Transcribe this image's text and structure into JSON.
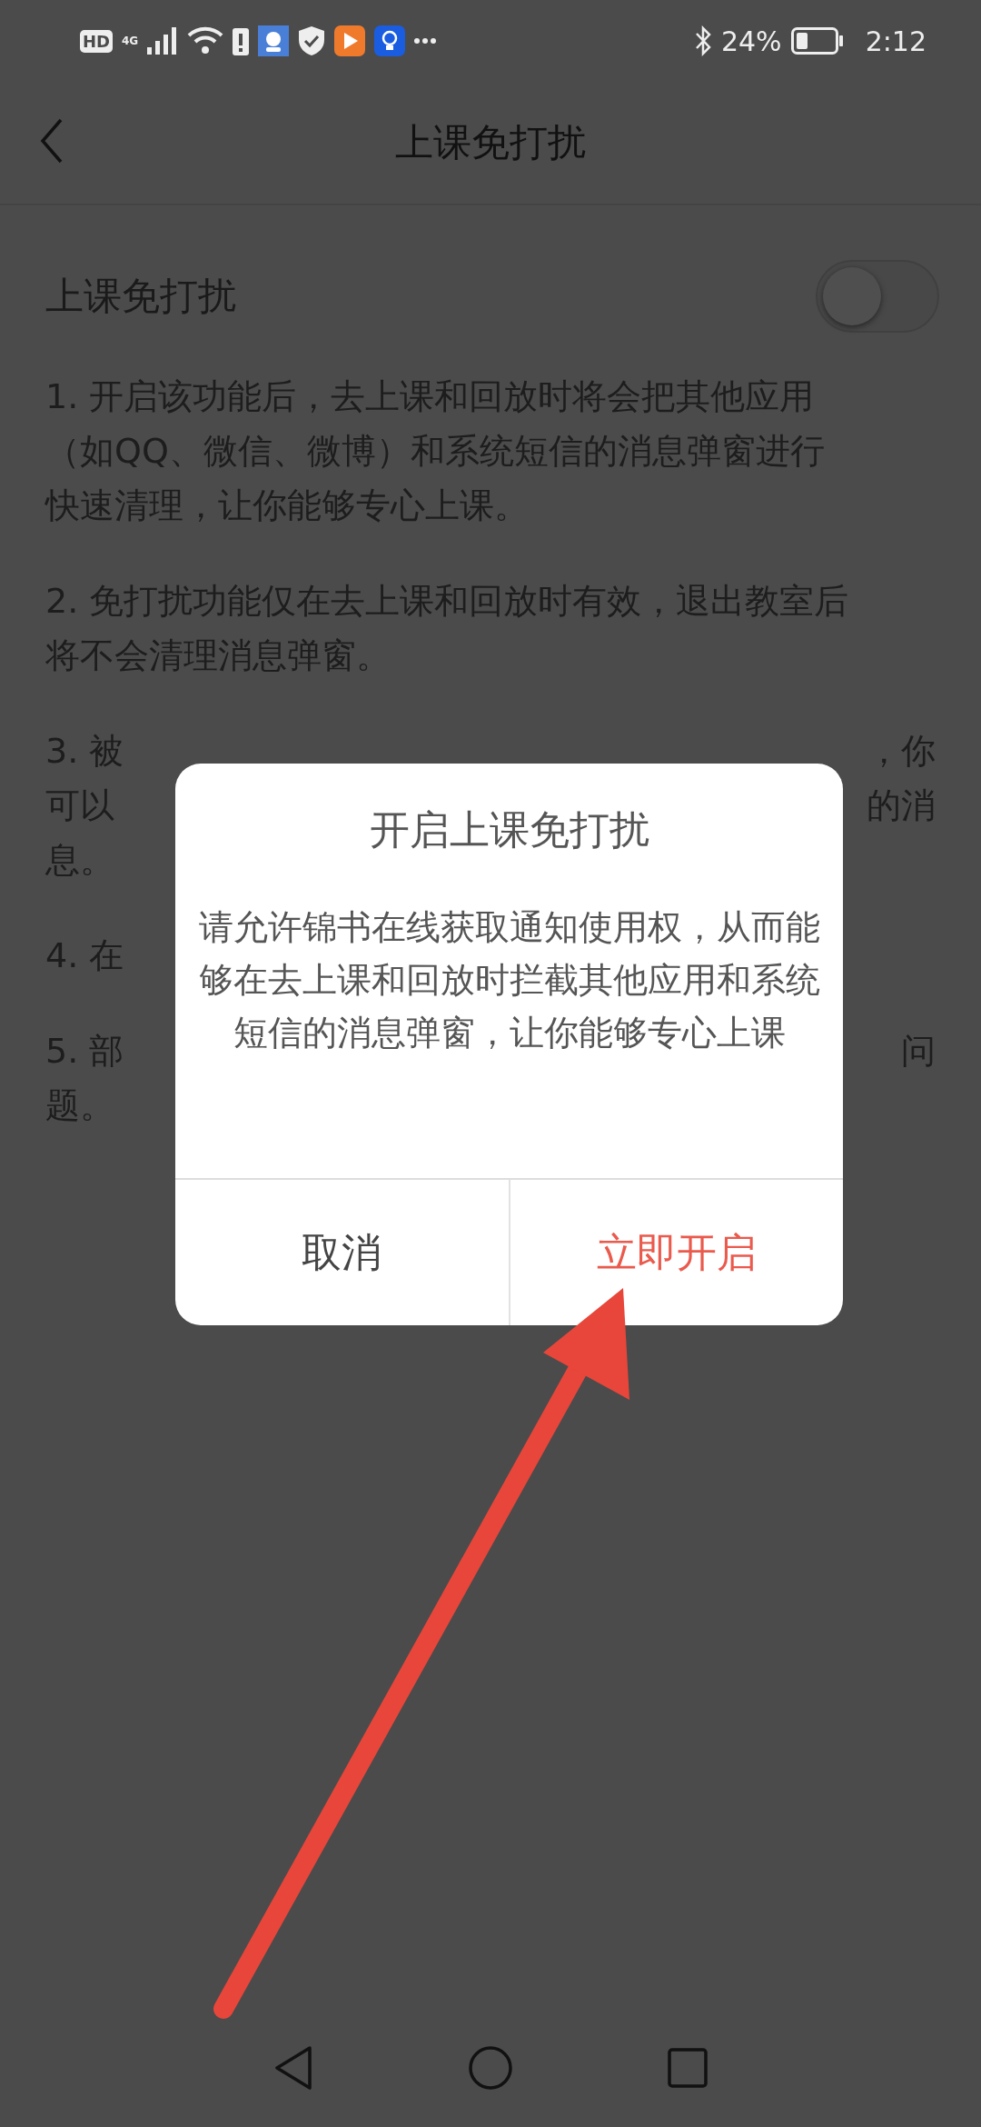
{
  "status_bar": {
    "hd": "HD",
    "network": "4G",
    "battery_percent": "24%",
    "time": "2:12"
  },
  "header": {
    "title": "上课免打扰"
  },
  "setting": {
    "label": "上课免打扰",
    "on": false
  },
  "paragraphs": [
    {
      "lines": [
        {
          "text": "1. 开启该功能后，去上课和回放时将会把其他应用"
        },
        {
          "text": "（如QQ、微信、微博）和系统短信的消息弹窗进行"
        },
        {
          "text": "快速清理，让你能够专心上课。"
        }
      ]
    },
    {
      "lines": [
        {
          "text": "2. 免打扰功能仅在去上课和回放时有效，退出教室后"
        },
        {
          "text": "将不会清理消息弹窗。"
        }
      ]
    },
    {
      "lines": [
        {
          "left": "3. 被",
          "right": "，你"
        },
        {
          "left": "可以",
          "right": "的消"
        },
        {
          "left": "息。"
        }
      ]
    },
    {
      "lines": [
        {
          "left": "4. 在"
        }
      ]
    },
    {
      "lines": [
        {
          "left": "5. 部",
          "right": "问"
        },
        {
          "left": "题。"
        }
      ]
    }
  ],
  "dialog": {
    "title": "开启上课免打扰",
    "message": "请允许锦书在线获取通知使用权，从而能够在去上课和回放时拦截其他应用和系统短信的消息弹窗，让你能够专心上课",
    "buttons": [
      {
        "label": "取消",
        "kind": "cancel"
      },
      {
        "label": "立即开启",
        "kind": "confirm"
      }
    ]
  }
}
